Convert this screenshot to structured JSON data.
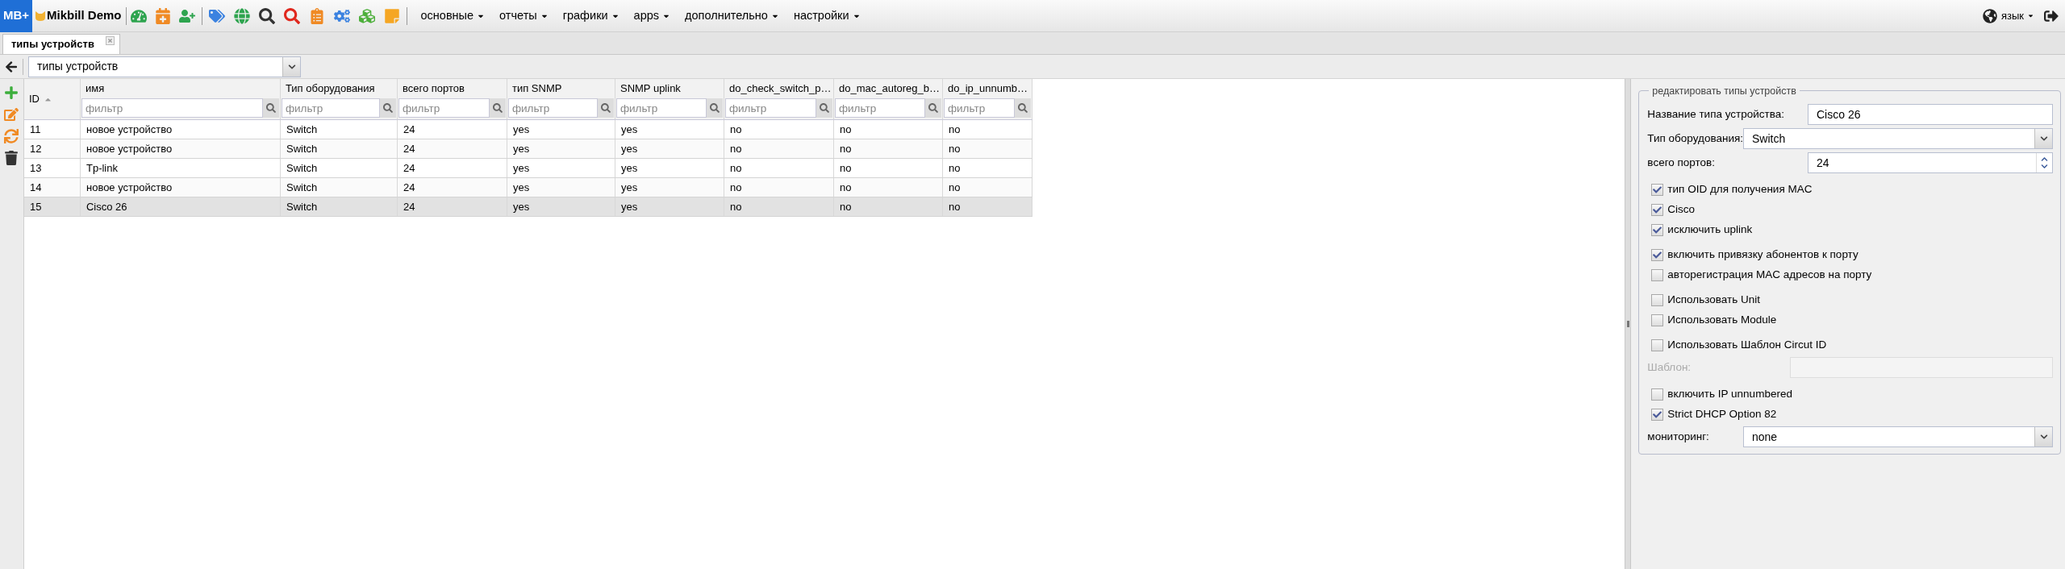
{
  "topbar": {
    "logo": "MB+",
    "brand": "Mikbill Demo",
    "menus": [
      {
        "label": "основные"
      },
      {
        "label": "отчеты"
      },
      {
        "label": "графики"
      },
      {
        "label": "apps"
      },
      {
        "label": "дополнительно"
      },
      {
        "label": "настройки"
      }
    ],
    "language": "язык"
  },
  "tabs": [
    {
      "label": "типы устройств",
      "selected": true
    }
  ],
  "toolbar": {
    "select_value": "типы устройств"
  },
  "table": {
    "columns": [
      {
        "label": "ID",
        "sorted": true
      },
      {
        "label": "имя",
        "sorted": false,
        "filter_placeholder": "фильтр"
      },
      {
        "label": "Тип оборудования",
        "sorted": false,
        "filter_placeholder": "фильтр"
      },
      {
        "label": "всего портов",
        "sorted": false,
        "filter_placeholder": "фильтр"
      },
      {
        "label": "тип SNMP",
        "sorted": false,
        "filter_placeholder": "фильтр"
      },
      {
        "label": "SNMP uplink",
        "sorted": false,
        "filter_placeholder": "фильтр"
      },
      {
        "label": "do_check_switch_p…",
        "sorted": false,
        "filter_placeholder": "фильтр"
      },
      {
        "label": "do_mac_autoreg_b…",
        "sorted": false,
        "filter_placeholder": "фильтр"
      },
      {
        "label": "do_ip_unnumb…",
        "sorted": false,
        "filter_placeholder": "фильтр"
      }
    ],
    "rows": [
      {
        "cells": [
          "11",
          "новое устройство",
          "Switch",
          "24",
          "yes",
          "yes",
          "no",
          "no",
          "no"
        ],
        "selected": false
      },
      {
        "cells": [
          "12",
          "новое устройство",
          "Switch",
          "24",
          "yes",
          "yes",
          "no",
          "no",
          "no"
        ],
        "selected": false
      },
      {
        "cells": [
          "13",
          "Tp-link",
          "Switch",
          "24",
          "yes",
          "yes",
          "no",
          "no",
          "no"
        ],
        "selected": false
      },
      {
        "cells": [
          "14",
          "новое устройство",
          "Switch",
          "24",
          "yes",
          "yes",
          "no",
          "no",
          "no"
        ],
        "selected": false
      },
      {
        "cells": [
          "15",
          "Cisco 26",
          "Switch",
          "24",
          "yes",
          "yes",
          "no",
          "no",
          "no"
        ],
        "selected": true
      }
    ]
  },
  "form": {
    "legend": "редактировать типы устройств",
    "groups": [
      [
        {
          "kind": "text",
          "label": "Название типа устройства:",
          "value": "Cisco 26",
          "disabled": false
        },
        {
          "kind": "select",
          "label": "Тип оборудования:",
          "value": "Switch"
        },
        {
          "kind": "number",
          "label": "всего портов:",
          "value": "24"
        }
      ],
      [
        {
          "kind": "checkbox",
          "label": "тип OID для получения MAC",
          "checked": true
        },
        {
          "kind": "checkbox",
          "label": "Cisco",
          "checked": true
        },
        {
          "kind": "checkbox",
          "label": "исключить uplink",
          "checked": true
        }
      ],
      [
        {
          "kind": "checkbox",
          "label": "включить привязку абонентов к порту",
          "checked": true
        },
        {
          "kind": "checkbox",
          "label": "авторегистрация MAC адресов на порту",
          "checked": false
        }
      ],
      [
        {
          "kind": "checkbox",
          "label": "Использовать Unit",
          "checked": false
        },
        {
          "kind": "checkbox",
          "label": "Использовать Module",
          "checked": false
        }
      ],
      [
        {
          "kind": "checkbox",
          "label": "Использовать Шаблон Circut ID",
          "checked": false
        },
        {
          "kind": "text",
          "label": "Шаблон:",
          "disabled": true
        }
      ],
      [
        {
          "kind": "checkbox",
          "label": "включить IP unnumbered",
          "checked": false
        },
        {
          "kind": "checkbox",
          "label": "Strict DHCP Option 82",
          "checked": true
        },
        {
          "kind": "select",
          "label": "мониторинг:",
          "value": "none"
        }
      ]
    ]
  }
}
